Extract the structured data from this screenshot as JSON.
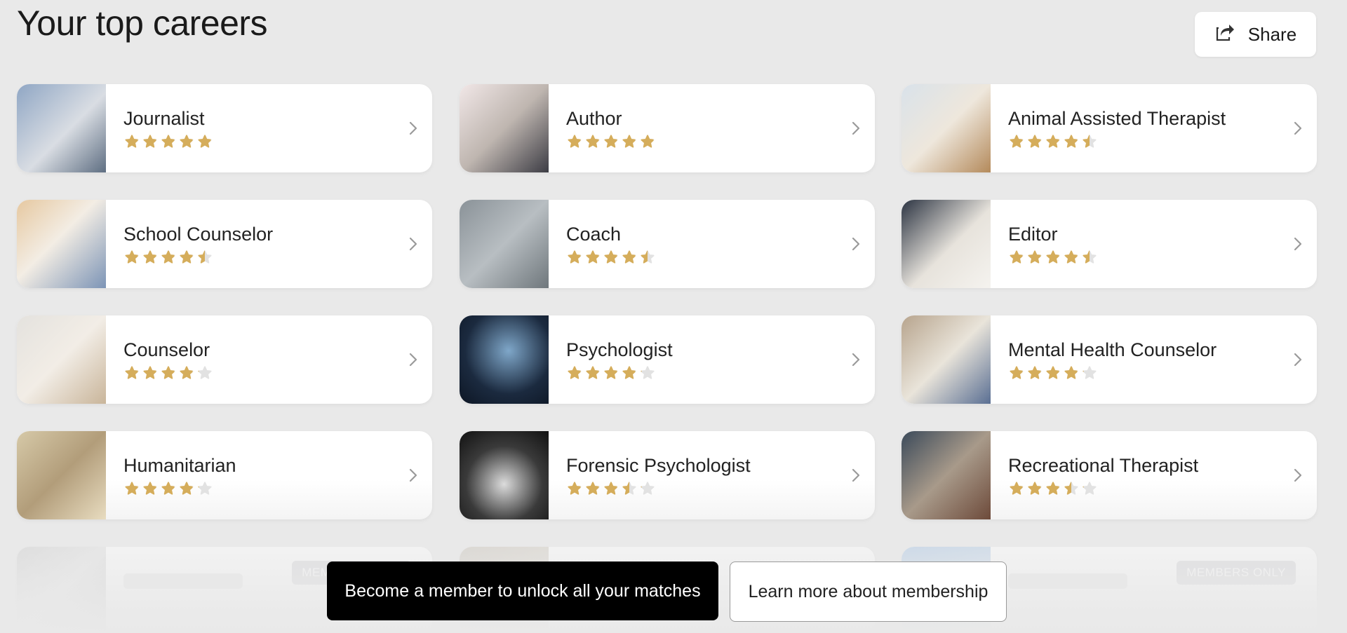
{
  "page": {
    "title": "Your top careers",
    "share_label": "Share"
  },
  "careers": [
    {
      "title": "Journalist",
      "rating": 5,
      "thumb": "journalist-photo"
    },
    {
      "title": "Author",
      "rating": 5,
      "thumb": "author-photo"
    },
    {
      "title": "Animal Assisted Therapist",
      "rating": 4.5,
      "thumb": "animal-assisted-therapist-photo"
    },
    {
      "title": "School Counselor",
      "rating": 4.5,
      "thumb": "school-counselor-photo"
    },
    {
      "title": "Coach",
      "rating": 4.5,
      "thumb": "coach-photo"
    },
    {
      "title": "Editor",
      "rating": 4.5,
      "thumb": "editor-photo"
    },
    {
      "title": "Counselor",
      "rating": 4,
      "thumb": "counselor-photo"
    },
    {
      "title": "Psychologist",
      "rating": 4,
      "thumb": "psychologist-photo"
    },
    {
      "title": "Mental Health Counselor",
      "rating": 4,
      "thumb": "mental-health-counselor-photo"
    },
    {
      "title": "Humanitarian",
      "rating": 4,
      "thumb": "humanitarian-photo"
    },
    {
      "title": "Forensic Psychologist",
      "rating": 3.5,
      "thumb": "forensic-psychologist-photo"
    },
    {
      "title": "Recreational Therapist",
      "rating": 3.5,
      "thumb": "recreational-therapist-photo"
    }
  ],
  "locked": {
    "badge_label": "MEMBERS ONLY"
  },
  "membership": {
    "cta_primary": "Become a member to unlock all your matches",
    "cta_secondary": "Learn more about membership"
  },
  "colors": {
    "star_filled": "#d5ad5b",
    "star_empty": "#e2e2e2",
    "background": "#e9e9e9"
  },
  "icons": {
    "share": "share-icon",
    "chevron": "chevron-right-icon",
    "star": "star-icon"
  }
}
